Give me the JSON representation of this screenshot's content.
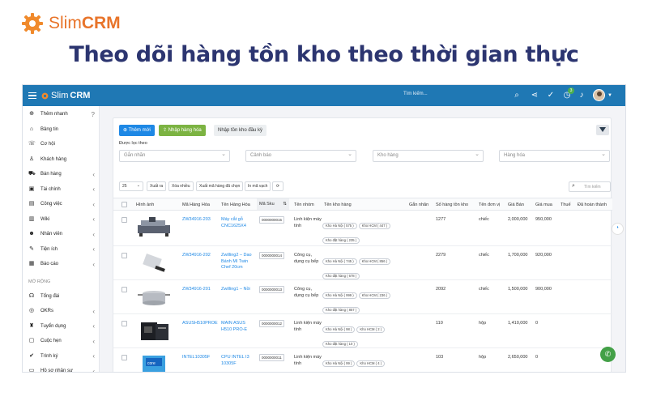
{
  "brand": {
    "name_light": "Slim",
    "name_bold": "CRM"
  },
  "headline": "Theo dõi hàng tồn kho theo thời gian thực",
  "topbar": {
    "logo_light": "Slim",
    "logo_bold": "CRM",
    "search_placeholder": "Tìm kiếm...",
    "badge": "3"
  },
  "sidebar": {
    "items": [
      {
        "icon": "plus-circle-icon",
        "glyph": "⊕",
        "label": "Thêm nhanh",
        "chevron": "?"
      },
      {
        "icon": "home-icon",
        "glyph": "⌂",
        "label": "Bảng tin",
        "chevron": ""
      },
      {
        "icon": "phone-icon",
        "glyph": "☏",
        "label": "Cơ hội",
        "chevron": ""
      },
      {
        "icon": "user-icon",
        "glyph": "♙",
        "label": "Khách hàng",
        "chevron": ""
      },
      {
        "icon": "cart-icon",
        "glyph": "⛟",
        "label": "Bán hàng",
        "chevron": "‹"
      },
      {
        "icon": "money-icon",
        "glyph": "▣",
        "label": "Tài chính",
        "chevron": "‹"
      },
      {
        "icon": "briefcase-icon",
        "glyph": "▤",
        "label": "Công việc",
        "chevron": "‹"
      },
      {
        "icon": "wiki-icon",
        "glyph": "▥",
        "label": "Wiki",
        "chevron": "‹"
      },
      {
        "icon": "staff-icon",
        "glyph": "☻",
        "label": "Nhân viên",
        "chevron": "‹"
      },
      {
        "icon": "wrench-icon",
        "glyph": "✎",
        "label": "Tiện ích",
        "chevron": "‹"
      },
      {
        "icon": "report-icon",
        "glyph": "▦",
        "label": "Báo cáo",
        "chevron": "‹"
      }
    ],
    "section_label": "MỞ RỘNG",
    "ext_items": [
      {
        "icon": "headset-icon",
        "glyph": "☊",
        "label": "Tổng đài",
        "chevron": ""
      },
      {
        "icon": "target-icon",
        "glyph": "◎",
        "label": "OKRs",
        "chevron": "‹"
      },
      {
        "icon": "grad-icon",
        "glyph": "♜",
        "label": "Tuyển dụng",
        "chevron": "‹"
      },
      {
        "icon": "calendar-icon",
        "glyph": "▢",
        "label": "Cuộc hẹn",
        "chevron": "‹"
      },
      {
        "icon": "approval-icon",
        "glyph": "✔",
        "label": "Trình ký",
        "chevron": "‹"
      },
      {
        "icon": "folder-icon",
        "glyph": "▭",
        "label": "Hồ sơ nhân sự",
        "chevron": "‹"
      }
    ]
  },
  "actions": {
    "add": "Thêm mới",
    "import": "Nhập hàng hóa",
    "import_stock": "Nhập tồn kho đầu kỳ"
  },
  "filters": {
    "label": "Được lọc theo",
    "items": [
      "Gắn nhãn",
      "Cảnh báo",
      "Kho hàng",
      "Hàng hóa"
    ]
  },
  "toolbar": {
    "page_size": "25",
    "buttons": [
      "Xuất ra",
      "Xóa nhiều",
      "Xuất mã hàng đã chọn",
      "In mã vạch"
    ],
    "search_placeholder": "Tìm kiếm"
  },
  "table": {
    "headers": [
      "Hình ảnh",
      "Mã Hàng Hóa",
      "Tên Hàng Hóa",
      "Mã Sku",
      "Tên nhóm",
      "Tên kho hàng",
      "Gắn nhãn",
      "Số hàng tồn kho",
      "Tên đơn vị",
      "Giá Bán",
      "Giá mua",
      "Thuế",
      "Đã hoàn thành"
    ],
    "rows": [
      {
        "image": "cnc-machine-image",
        "code": "ZW34916-203",
        "name": "Máy cắt gỗ CNC1625X4",
        "sku": "0000000015",
        "group": "Linh kiện máy tính",
        "tags": [
          "Kho Hà Nội ( 575 )",
          "Kho HCM ( 447 )",
          "Kho đặt hàng ( 235 )"
        ],
        "stock": "1277",
        "unit": "chiếc",
        "price": "2,000,000",
        "cost": "950,000"
      },
      {
        "image": "cleaver-image",
        "code": "ZW34916-202",
        "name": "Zwilling2 – Dao Bánh Mì Twin Chef 20cm",
        "sku": "0000000014",
        "group": "Công cụ, dụng cụ bếp",
        "tags": [
          "Kho Hà Nội ( 745 )",
          "Kho HCM ( 856 )",
          "Kho đặt hàng ( 678 )"
        ],
        "stock": "2279",
        "unit": "chiếc",
        "price": "1,700,000",
        "cost": "920,000"
      },
      {
        "image": "pot-image",
        "code": "ZW34916-201",
        "name": "Zwilling1 – Nồi",
        "sku": "0000000013",
        "group": "Công cụ, dụng cụ bếp",
        "tags": [
          "Kho Hà Nội ( 999 )",
          "Kho HCM ( 236 )",
          "Kho đặt hàng ( 857 )"
        ],
        "stock": "2092",
        "unit": "chiếc",
        "price": "1,500,000",
        "cost": "900,000"
      },
      {
        "image": "motherboard-image",
        "code": "ASUSH510PROE",
        "name": "MAIN ASUS H510 PRO-E",
        "sku": "0000000012",
        "group": "Linh kiện máy tính",
        "tags": [
          "Kho Hà Nội ( 98 )",
          "Kho HCM ( 2 )",
          "Kho đặt hàng ( 10 )"
        ],
        "stock": "110",
        "unit": "hộp",
        "price": "1,410,000",
        "cost": "0"
      },
      {
        "image": "cpu-box-image",
        "code": "INTEL10305F",
        "name": "CPU INTEL I3 10305F",
        "sku": "0000000011",
        "group": "Linh kiện máy tính",
        "tags": [
          "Kho Hà Nội ( 99 )",
          "Kho HCM ( 4 )"
        ],
        "stock": "103",
        "unit": "hộp",
        "price": "2,650,000",
        "cost": "0"
      }
    ]
  }
}
